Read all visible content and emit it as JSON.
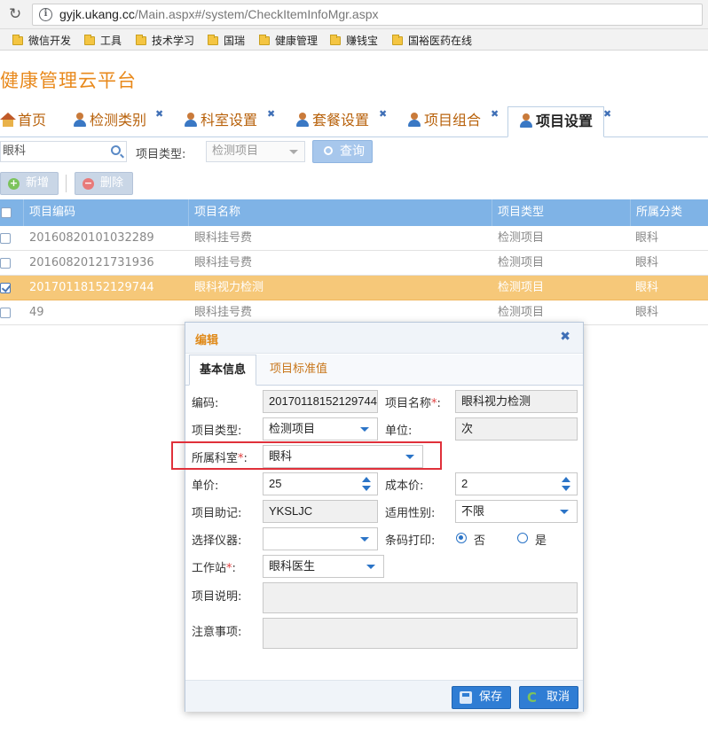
{
  "browser": {
    "url_host": "gyjk.ukang.cc",
    "url_path": "/Main.aspx#/system/CheckItemInfoMgr.aspx",
    "bookmarks": [
      "微信开发",
      "工具",
      "技术学习",
      "国瑞",
      "健康管理",
      "赚钱宝",
      "国裕医药在线"
    ]
  },
  "app": {
    "title": "健康管理云平台"
  },
  "tabs": [
    {
      "label": "首页"
    },
    {
      "label": "检测类别"
    },
    {
      "label": "科室设置"
    },
    {
      "label": "套餐设置"
    },
    {
      "label": "项目组合"
    },
    {
      "label": "项目设置"
    }
  ],
  "search": {
    "keyword_value": "眼科",
    "type_label": "项目类型:",
    "type_value": "检测项目",
    "query_label": "查询"
  },
  "toolbar": {
    "add_label": "新增",
    "delete_label": "删除"
  },
  "grid": {
    "columns": [
      "项目编码",
      "项目名称",
      "项目类型",
      "所属分类"
    ],
    "rows": [
      {
        "code": "20160820101032289",
        "name": "眼科挂号费",
        "type": "检测项目",
        "category": "眼科",
        "checked": false
      },
      {
        "code": "20160820121731936",
        "name": "眼科挂号费",
        "type": "检测项目",
        "category": "眼科",
        "checked": false
      },
      {
        "code": "20170118152129744",
        "name": "眼科视力检测",
        "type": "检测项目",
        "category": "眼科",
        "checked": true
      },
      {
        "code": "49",
        "name": "眼科挂号费",
        "type": "检测项目",
        "category": "眼科",
        "checked": false
      }
    ]
  },
  "dialog": {
    "title": "编辑",
    "tabs": [
      "基本信息",
      "项目标准值"
    ],
    "fields": {
      "code_label": "编码:",
      "code_value": "20170118152129744",
      "name_label": "项目名称",
      "name_value": "眼科视力检测",
      "type_label": "项目类型:",
      "type_value": "检测项目",
      "unit_label": "单位:",
      "unit_value": "次",
      "dept_label": "所属科室",
      "dept_value": "眼科",
      "price_label": "单价:",
      "price_value": "25",
      "cost_label": "成本价:",
      "cost_value": "2",
      "mnemonic_label": "项目助记:",
      "mnemonic_value": "YKSLJC",
      "gender_label": "适用性别:",
      "gender_value": "不限",
      "instrument_label": "选择仪器:",
      "instrument_value": "",
      "barcode_label": "条码打印:",
      "barcode_no": "否",
      "barcode_yes": "是",
      "station_label": "工作站",
      "station_value": "眼科医生",
      "desc_label": "项目说明:",
      "notes_label": "注意事项:",
      "colon": ":",
      "required_mark": "*"
    },
    "save_label": "保存",
    "cancel_label": "取消"
  }
}
